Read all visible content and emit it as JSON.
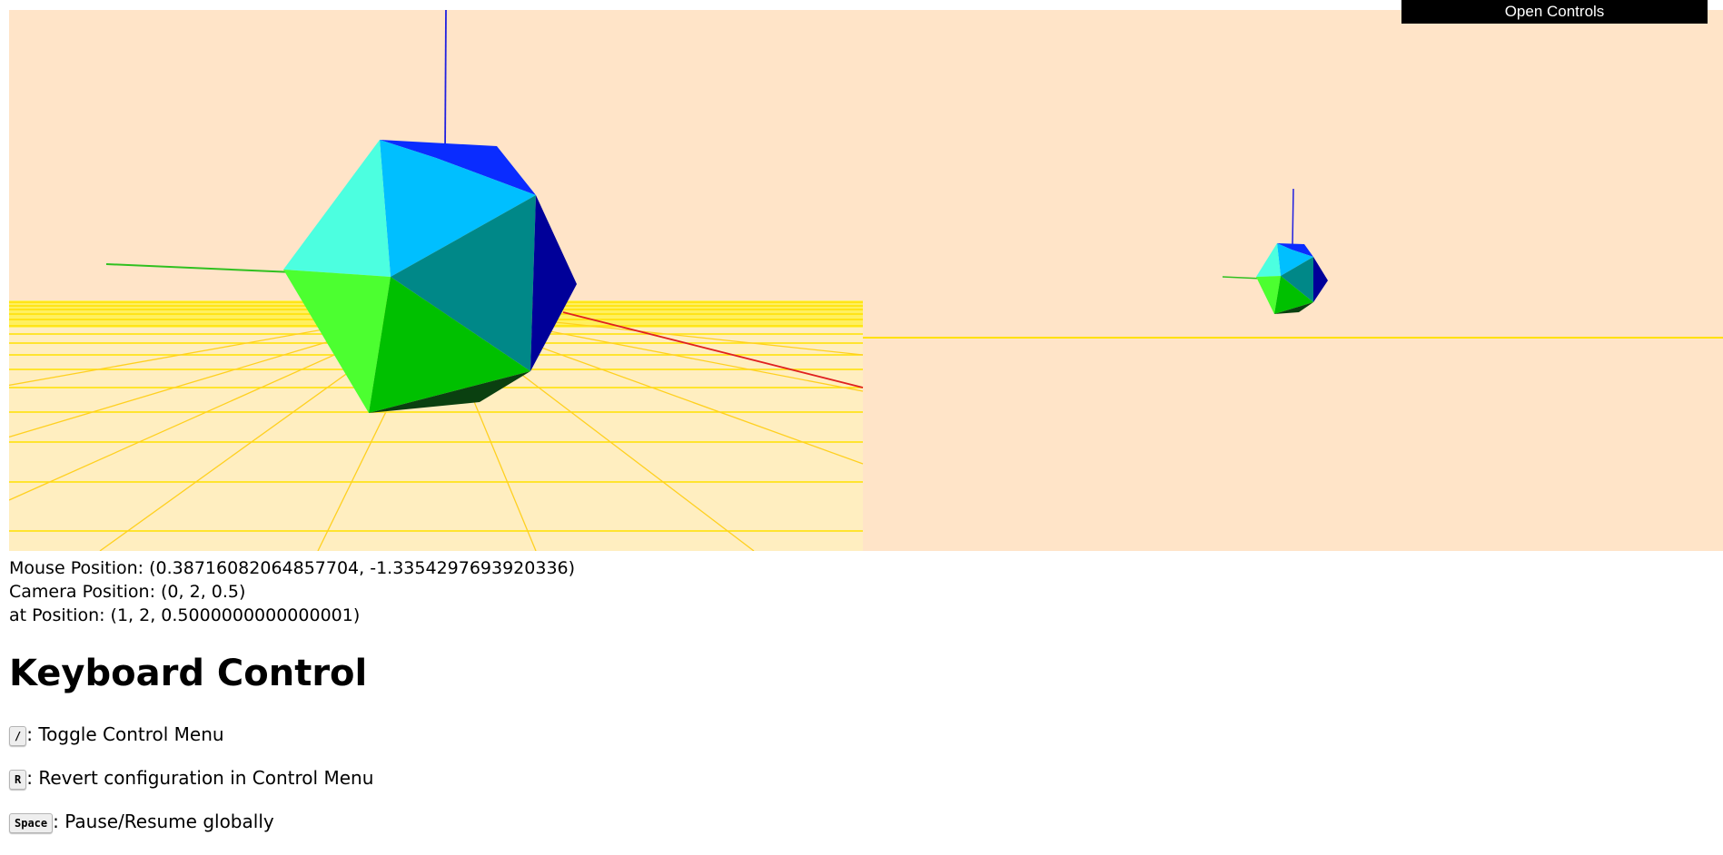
{
  "controls": {
    "open_label": "Open Controls"
  },
  "readouts": {
    "mouse": "Mouse Position: (0.38716082064857704, -1.3354297693920336)",
    "camera": "Camera Position: (0, 2, 0.5)",
    "at": "at Position: (1, 2, 0.5000000000000001)"
  },
  "keyboard": {
    "title": "Keyboard Control",
    "items": [
      {
        "key": "/",
        "desc": ": Toggle Control Menu"
      },
      {
        "key": "R",
        "desc": ": Revert configuration in Control Menu"
      },
      {
        "key": "Space",
        "desc": ": Pause/Resume globally"
      }
    ]
  },
  "colors": {
    "canvas_bg": "#ffe4c8",
    "grid_line": "#ffe000",
    "x_axis": "#e02020",
    "y_axis": "#30c020",
    "z_axis": "#2020e0"
  }
}
